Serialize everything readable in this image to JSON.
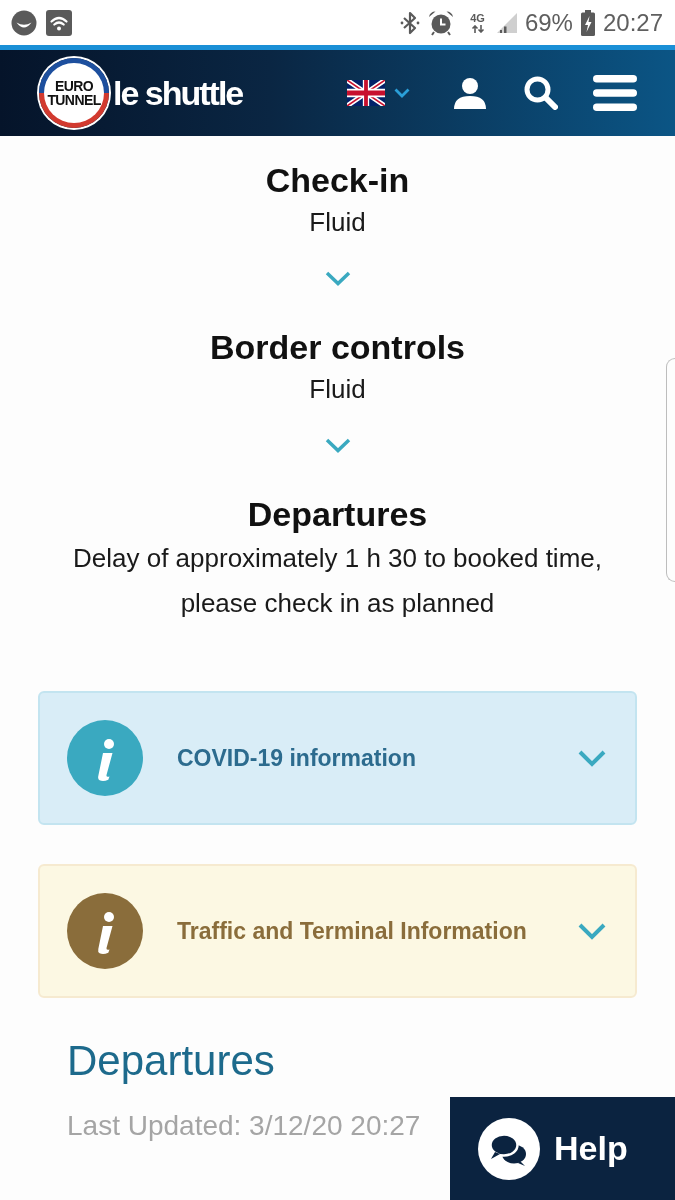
{
  "status_bar": {
    "network": "4G",
    "battery": "69%",
    "time": "20:27"
  },
  "header": {
    "logo_badge": "EURO TUNNEL",
    "logo_text": "le shuttle"
  },
  "statuses": [
    {
      "title": "Check-in",
      "value": "Fluid"
    },
    {
      "title": "Border controls",
      "value": "Fluid"
    },
    {
      "title": "Departures",
      "value": "Delay of approximately 1 h 30 to booked time, please check in as planned"
    }
  ],
  "alerts": [
    {
      "kind": "info",
      "title": "COVID-19 information",
      "expanded": false
    },
    {
      "kind": "warning",
      "title": "Traffic and Terminal Information",
      "expanded": false
    }
  ],
  "departures": {
    "title": "Departures",
    "last_updated": "Last Updated: 3/12/20 20:27"
  },
  "help_button": {
    "label": "Help"
  }
}
